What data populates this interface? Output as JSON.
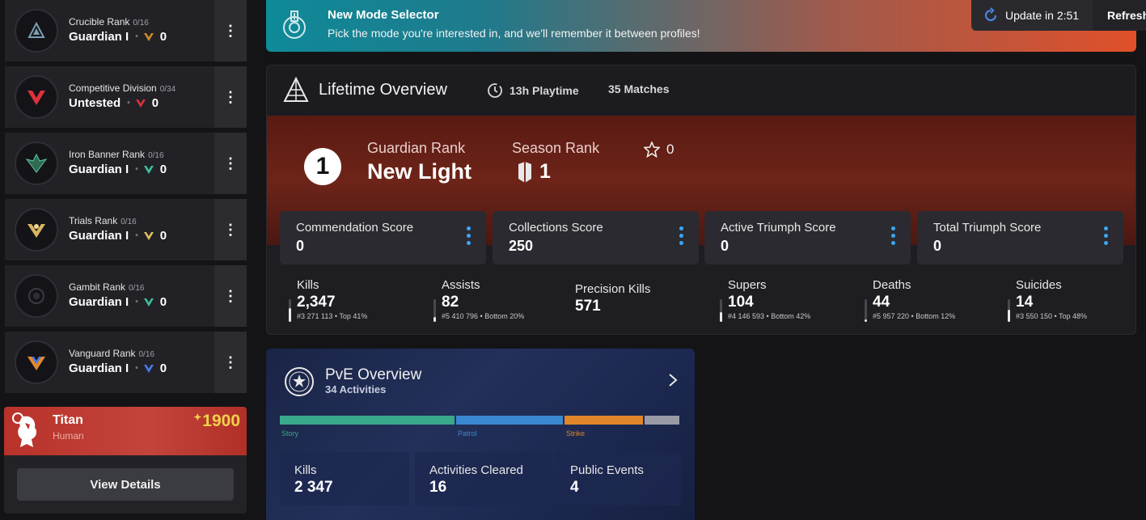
{
  "ranks": [
    {
      "name": "Crucible Rank",
      "progress": "0/16",
      "value": "Guardian I",
      "count": "0",
      "color": "#d08a2a"
    },
    {
      "name": "Competitive Division",
      "progress": "0/34",
      "value": "Untested",
      "count": "0",
      "color": "#e0303a"
    },
    {
      "name": "Iron Banner Rank",
      "progress": "0/16",
      "value": "Guardian I",
      "count": "0",
      "color": "#3cc0a0"
    },
    {
      "name": "Trials Rank",
      "progress": "0/16",
      "value": "Guardian I",
      "count": "0",
      "color": "#e0c060"
    },
    {
      "name": "Gambit Rank",
      "progress": "0/16",
      "value": "Guardian I",
      "count": "0",
      "color": "#3cc0a0"
    },
    {
      "name": "Vanguard Rank",
      "progress": "0/16",
      "value": "Guardian I",
      "count": "0",
      "color": "#4a7af0"
    }
  ],
  "character": {
    "class": "Titan",
    "race": "Human",
    "power": "1900",
    "details_label": "View Details",
    "color": "#b8322a"
  },
  "banner": {
    "title": "New Mode Selector",
    "description": "Pick the mode you're interested in, and we'll remember it between profiles!",
    "update_label": "Update in 2:51",
    "refresh_label": "Refresh"
  },
  "lifetime": {
    "title": "Lifetime Overview",
    "playtime": "13h Playtime",
    "matches": "35 Matches",
    "guardian_rank_number": "1",
    "guardian_rank_label": "Guardian Rank",
    "guardian_rank_value": "New Light",
    "season_rank_label": "Season Rank",
    "season_rank_value": "1",
    "stars": "0",
    "scores": [
      {
        "label": "Commendation Score",
        "value": "0"
      },
      {
        "label": "Collections Score",
        "value": "250"
      },
      {
        "label": "Active Triumph Score",
        "value": "0"
      },
      {
        "label": "Total Triumph Score",
        "value": "0"
      }
    ],
    "stats": [
      {
        "label": "Kills",
        "value": "2,347",
        "rank": "#3 271 113 • Top 41%",
        "level": 0.59
      },
      {
        "label": "Assists",
        "value": "82",
        "rank": "#5 410 796 • Bottom 20%",
        "level": 0.2
      },
      {
        "label": "Precision Kills",
        "value": "571",
        "rank": "",
        "level": null
      },
      {
        "label": "Supers",
        "value": "104",
        "rank": "#4 146 593 • Bottom 42%",
        "level": 0.42
      },
      {
        "label": "Deaths",
        "value": "44",
        "rank": "#5 957 220 • Bottom 12%",
        "level": 0.12
      },
      {
        "label": "Suicides",
        "value": "14",
        "rank": "#3 550 150 • Top 48%",
        "level": 0.52
      }
    ]
  },
  "pve": {
    "title": "PvE Overview",
    "subtitle": "34 Activities",
    "segments": [
      {
        "label": "Story",
        "share": 0.44,
        "color": "#3aa88a"
      },
      {
        "label": "Patrol",
        "share": 0.27,
        "color": "#3a88d0"
      },
      {
        "label": "Strike",
        "share": 0.2,
        "color": "#e0862a"
      },
      {
        "label": "",
        "share": 0.09,
        "color": "#9a9aa6"
      }
    ],
    "stats": [
      {
        "label": "Kills",
        "value": "2 347"
      },
      {
        "label": "Activities Cleared",
        "value": "16"
      },
      {
        "label": "Public Events",
        "value": "4"
      }
    ]
  }
}
